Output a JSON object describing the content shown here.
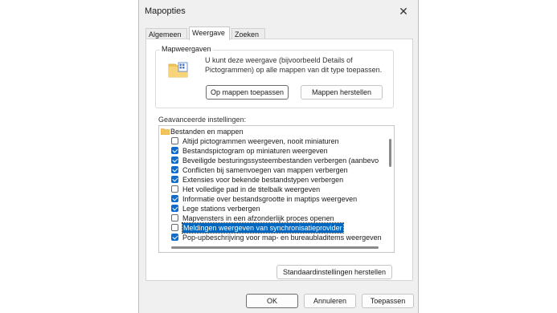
{
  "window": {
    "title": "Mapopties",
    "close_glyph": "✕"
  },
  "tabs": [
    {
      "label": "Algemeen",
      "active": false
    },
    {
      "label": "Weergave",
      "active": true
    },
    {
      "label": "Zoeken",
      "active": false
    }
  ],
  "folder_views": {
    "group_label": "Mapweergaven",
    "description": "U kunt deze weergave (bijvoorbeeld Details of Pictogrammen) op alle mappen van dit type toepassen.",
    "apply_button": "Op mappen toepassen",
    "reset_button": "Mappen herstellen"
  },
  "advanced": {
    "label": "Geavanceerde instellingen:",
    "root_label": "Bestanden en mappen",
    "items": [
      {
        "label": "Altijd pictogrammen weergeven, nooit miniaturen",
        "checked": false
      },
      {
        "label": "Bestandspictogram op miniaturen weergeven",
        "checked": true
      },
      {
        "label": "Beveiligde besturingssysteembestanden verbergen (aanbevo",
        "checked": true
      },
      {
        "label": "Conflicten bij samenvoegen van mappen verbergen",
        "checked": true
      },
      {
        "label": "Extensies voor bekende bestandstypen verbergen",
        "checked": true
      },
      {
        "label": "Het volledige pad in de titelbalk weergeven",
        "checked": false
      },
      {
        "label": "Informatie over bestandsgrootte in maptips weergeven",
        "checked": true
      },
      {
        "label": "Lege stations verbergen",
        "checked": true
      },
      {
        "label": "Mapvensters in een afzonderlijk proces openen",
        "checked": false
      },
      {
        "label": "Meldingen weergeven van synchronisatieprovider",
        "checked": false,
        "selected": true
      },
      {
        "label": "Pop-upbeschrijving voor map- en bureaubladitems weergeven",
        "checked": true
      }
    ],
    "restore_button": "Standaardinstellingen herstellen"
  },
  "footer": {
    "ok": "OK",
    "cancel": "Annuleren",
    "apply": "Toepassen"
  },
  "colors": {
    "accent": "#0f6ccf",
    "selection": "#0067c0",
    "folder": "#f2c55c"
  }
}
